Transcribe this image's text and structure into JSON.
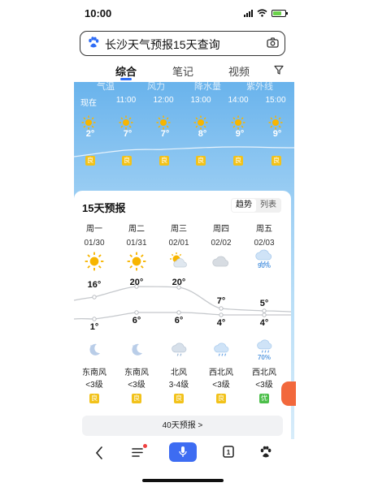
{
  "status": {
    "time": "10:00"
  },
  "search": {
    "query": "长沙天气预报15天查询"
  },
  "tabs": [
    "综合",
    "笔记",
    "视频"
  ],
  "hourly": {
    "param_tabs": [
      "气温",
      "风力",
      "降水量",
      "紫外线"
    ],
    "hours": [
      {
        "time": "现在",
        "temp": "2°",
        "aq": "良"
      },
      {
        "time": "11:00",
        "temp": "7°",
        "aq": "良"
      },
      {
        "time": "12:00",
        "temp": "7°",
        "aq": "良"
      },
      {
        "time": "13:00",
        "temp": "8°",
        "aq": "良"
      },
      {
        "time": "14:00",
        "temp": "9°",
        "aq": "良"
      },
      {
        "time": "15:00",
        "temp": "9°",
        "aq": "良"
      }
    ]
  },
  "forecast": {
    "title": "15天预报",
    "toggle": [
      "趋势",
      "列表"
    ],
    "days": [
      {
        "name": "周一",
        "date": "01/30",
        "day_icon": "sun-icon",
        "precip": "",
        "high": "16°",
        "low": "1°",
        "night_icon": "moon-icon",
        "night_precip": "",
        "wind_dir": "东南风",
        "wind_lvl": "<3级",
        "aq": "良",
        "aq_color": "#f2c21a"
      },
      {
        "name": "周二",
        "date": "01/31",
        "day_icon": "sun-icon",
        "precip": "",
        "high": "20°",
        "low": "6°",
        "night_icon": "moon-icon",
        "night_precip": "",
        "wind_dir": "东南风",
        "wind_lvl": "<3级",
        "aq": "良",
        "aq_color": "#f2c21a"
      },
      {
        "name": "周三",
        "date": "02/01",
        "day_icon": "partly-cloudy-icon",
        "precip": "",
        "high": "20°",
        "low": "6°",
        "night_icon": "cloud-icon",
        "night_precip": "",
        "wind_dir": "北风",
        "wind_lvl": "3-4级",
        "aq": "良",
        "aq_color": "#f2c21a"
      },
      {
        "name": "周四",
        "date": "02/02",
        "day_icon": "cloud-icon",
        "precip": "",
        "high": "7°",
        "low": "4°",
        "night_icon": "rain-icon",
        "night_precip": "",
        "wind_dir": "西北风",
        "wind_lvl": "<3级",
        "aq": "良",
        "aq_color": "#f2c21a"
      },
      {
        "name": "周五",
        "date": "02/03",
        "day_icon": "rain-icon",
        "precip": "90%",
        "high": "5°",
        "low": "4°",
        "night_icon": "rain-icon",
        "night_precip": "70%",
        "wind_dir": "西北风",
        "wind_lvl": "<3级",
        "aq": "优",
        "aq_color": "#4cbf4a"
      }
    ],
    "more_label": "40天预报 >"
  },
  "colors": {
    "accent": "#2f6df6",
    "sky": "#69b3ec",
    "sun": "#f7b500"
  }
}
